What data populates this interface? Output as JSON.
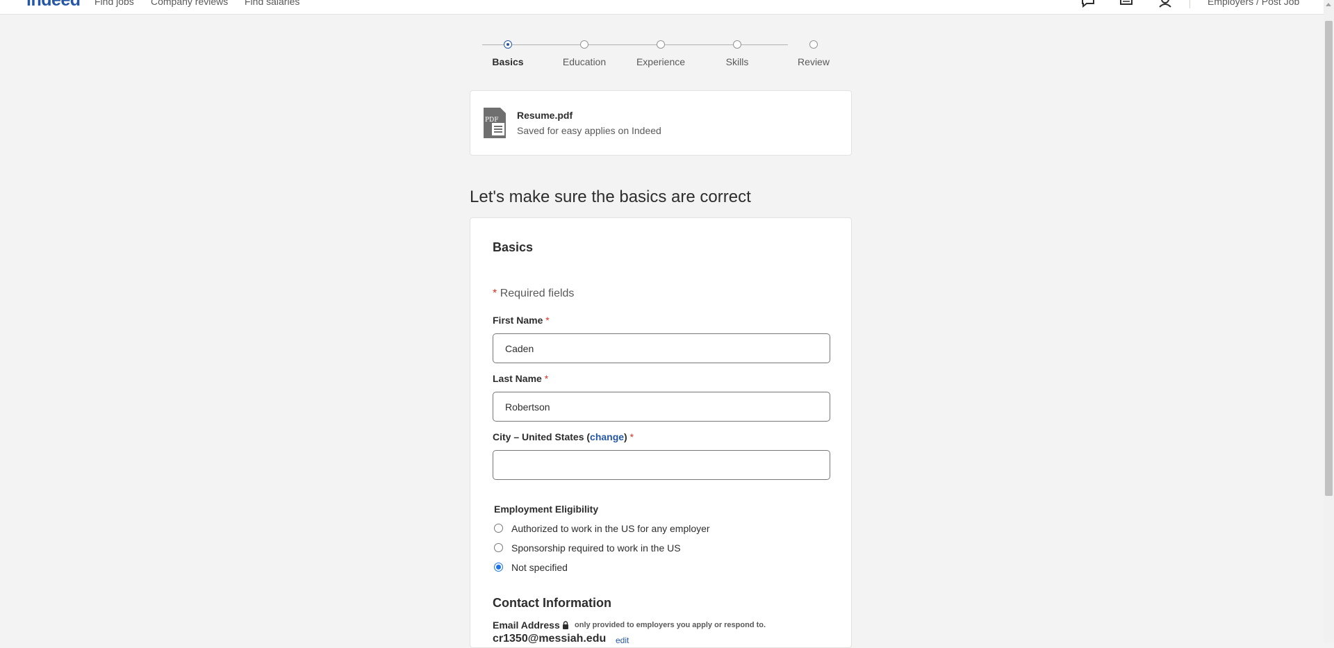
{
  "topnav": {
    "logo": "indeed",
    "links": [
      "Find jobs",
      "Company reviews",
      "Find salaries"
    ],
    "icons": [
      "messages-icon",
      "notifications-icon",
      "profile-icon"
    ],
    "employers": "Employers / Post Job"
  },
  "stepper": {
    "steps": [
      {
        "label": "Basics",
        "active": true
      },
      {
        "label": "Education",
        "active": false
      },
      {
        "label": "Experience",
        "active": false
      },
      {
        "label": "Skills",
        "active": false
      },
      {
        "label": "Review",
        "active": false
      }
    ]
  },
  "resume": {
    "filename": "Resume.pdf",
    "subtitle": "Saved for easy applies on Indeed",
    "icon": "pdf-file-icon",
    "icon_text": "PDF"
  },
  "page_heading": "Let's make sure the basics are correct",
  "form": {
    "title": "Basics",
    "required_star": "*",
    "required_note": "Required fields",
    "first_name": {
      "label": "First Name",
      "value": "Caden"
    },
    "last_name": {
      "label": "Last Name",
      "value": "Robertson"
    },
    "city": {
      "label_prefix": "City – United States (",
      "change_link": "change",
      "label_suffix": ")",
      "value": ""
    },
    "eligibility": {
      "label": "Employment Eligibility",
      "options": [
        {
          "label": "Authorized to work in the US for any employer",
          "checked": false
        },
        {
          "label": "Sponsorship required to work in the US",
          "checked": false
        },
        {
          "label": "Not specified",
          "checked": true
        }
      ]
    },
    "contact": {
      "title": "Contact Information",
      "email_label": "Email Address",
      "email_note": "only provided to employers you apply or respond to.",
      "email_value": "cr1350@messiah.edu",
      "edit_link": "edit"
    }
  },
  "colors": {
    "brand": "#2557a7",
    "required": "#d93025",
    "radio_checked": "#1a73e8",
    "page_bg": "#f3f3f3"
  }
}
